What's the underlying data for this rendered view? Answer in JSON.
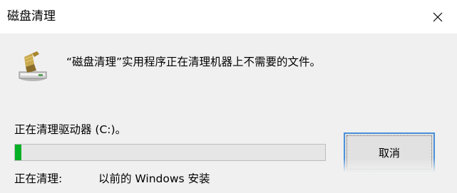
{
  "window": {
    "title": "磁盘清理",
    "close_icon": "close-icon"
  },
  "main": {
    "icon": "disk-cleanup-broom-icon",
    "description": "“磁盘清理”实用程序正在清理机器上不需要的文件。",
    "drive_text": "正在清理驱动器 (C:)。",
    "progress": 0.02,
    "status_label": "正在清理:",
    "status_value": "以前的 Windows 安装"
  },
  "buttons": {
    "cancel_label": "取消"
  },
  "colors": {
    "progress_fill": "#06b025",
    "accent": "#4a90d9"
  }
}
